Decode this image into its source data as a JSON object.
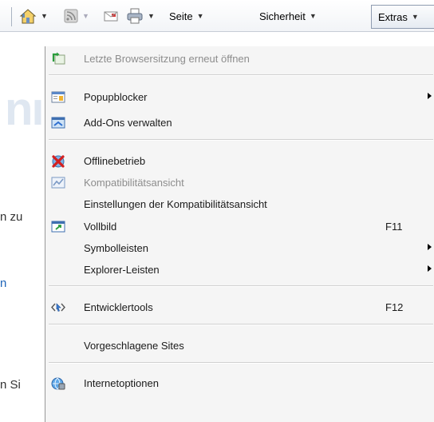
{
  "toolbar": {
    "seite_label": "Seite",
    "sicherheit_label": "Sicherheit",
    "extras_label": "Extras"
  },
  "page_background": {
    "line1": "n zu",
    "line2": "n",
    "line3": "n Si"
  },
  "menu": {
    "items": [
      {
        "label": "Letzte Browsersitzung erneut öffnen",
        "icon": "reopen-session-icon",
        "enabled": false
      },
      {
        "label": "Popupblocker",
        "icon": "popup-blocker-icon",
        "submenu": true
      },
      {
        "label": "Add-Ons verwalten",
        "icon": "add-ons-icon"
      },
      {
        "label": "Offlinebetrieb",
        "icon": "offline-icon"
      },
      {
        "label": "Kompatibilitätsansicht",
        "icon": "compatibility-view-icon",
        "enabled": false
      },
      {
        "label": "Einstellungen der Kompatibilitätsansicht"
      },
      {
        "label": "Vollbild",
        "icon": "fullscreen-icon",
        "shortcut": "F11"
      },
      {
        "label": "Symbolleisten",
        "submenu": true
      },
      {
        "label": "Explorer-Leisten",
        "submenu": true
      },
      {
        "label": "Entwicklertools",
        "icon": "developer-tools-icon",
        "shortcut": "F12"
      },
      {
        "label": "Vorgeschlagene Sites"
      },
      {
        "label": "Internetoptionen",
        "icon": "internet-options-icon"
      }
    ]
  }
}
